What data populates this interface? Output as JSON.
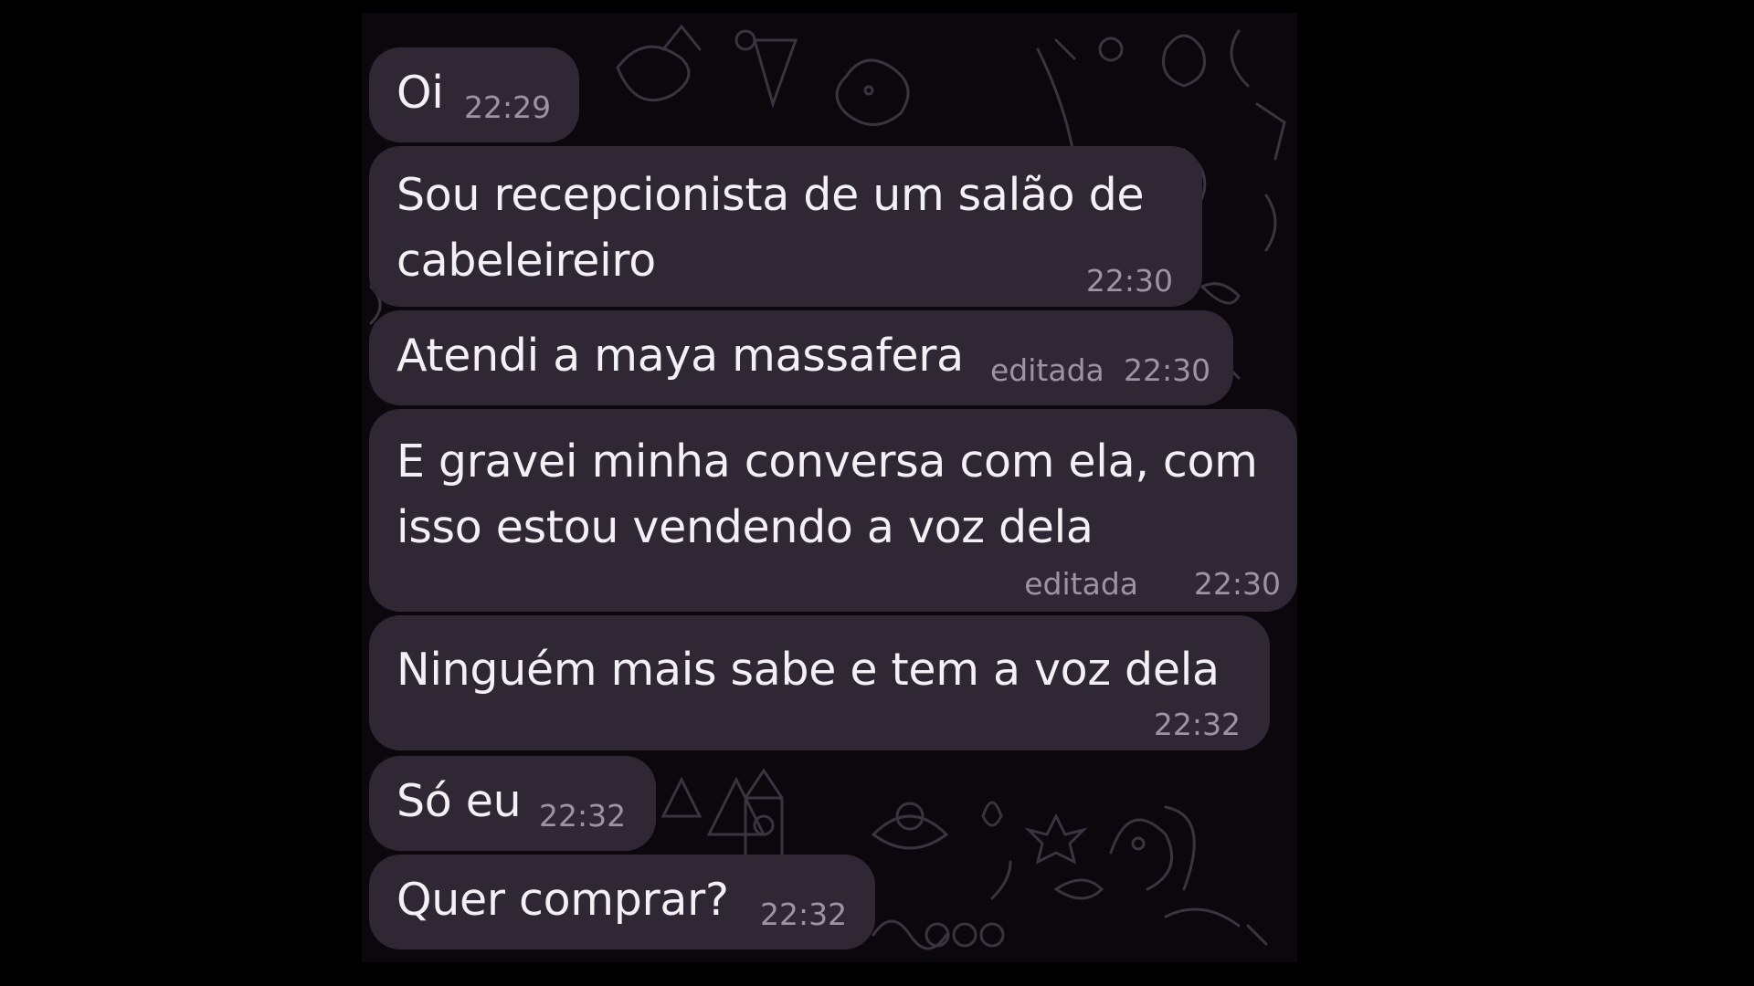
{
  "chat": {
    "messages": [
      {
        "lines": [
          "Oi"
        ],
        "edited": "",
        "time": "22:29"
      },
      {
        "lines": [
          "Sou recepcionista de um salão de",
          "cabeleireiro"
        ],
        "edited": "",
        "time": "22:30"
      },
      {
        "lines": [
          "Atendi a maya massafera"
        ],
        "edited": "editada",
        "time": "22:30"
      },
      {
        "lines": [
          "E gravei minha conversa com ela, com",
          "isso estou vendendo a voz dela"
        ],
        "edited": "editada",
        "time": "22:30"
      },
      {
        "lines": [
          "Ninguém mais sabe e tem a voz dela"
        ],
        "edited": "",
        "time": "22:32"
      },
      {
        "lines": [
          "Só eu"
        ],
        "edited": "",
        "time": "22:32"
      },
      {
        "lines": [
          "Quer comprar?"
        ],
        "edited": "",
        "time": "22:32"
      }
    ]
  },
  "colors": {
    "screen_background": "#000000",
    "chat_background": "#0b070d",
    "bubble": "#2f2834",
    "message_text": "#f3f1f5",
    "meta_text": "#9c94a4",
    "doodle_lines": "#3a3440"
  }
}
